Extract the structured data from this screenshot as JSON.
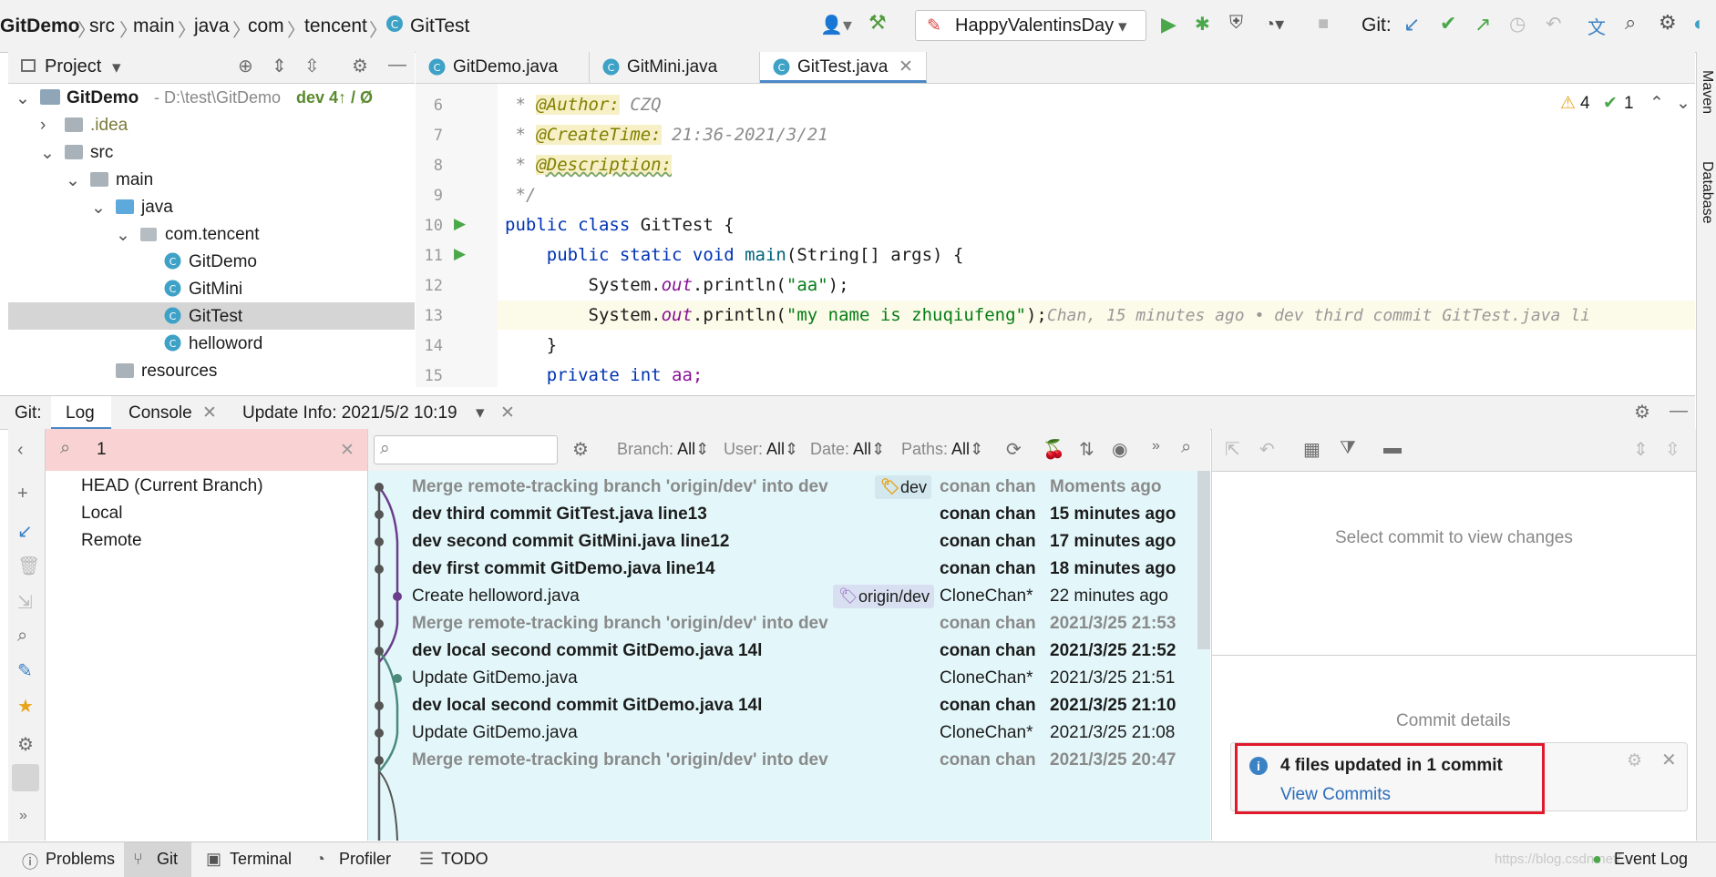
{
  "navbar": {
    "breadcrumbs": [
      "GitDemo",
      "src",
      "main",
      "java",
      "com",
      "tencent",
      "GitTest"
    ],
    "run_config": "HappyValentinsDay",
    "git_label": "Git:"
  },
  "project_panel": {
    "title": "Project",
    "root": {
      "name": "GitDemo",
      "path": "- D:\\test\\GitDemo",
      "branch": "dev 4↑ / Ø"
    },
    "items": [
      {
        "label": ".idea"
      },
      {
        "label": "src"
      },
      {
        "label": "main"
      },
      {
        "label": "java"
      },
      {
        "label": "com.tencent"
      },
      {
        "label": "GitDemo"
      },
      {
        "label": "GitMini"
      },
      {
        "label": "GitTest"
      },
      {
        "label": "helloword"
      },
      {
        "label": "resources"
      }
    ]
  },
  "editor": {
    "tabs": [
      {
        "label": "GitDemo.java"
      },
      {
        "label": "GitMini.java"
      },
      {
        "label": "GitTest.java"
      }
    ],
    "inspection": {
      "warnings": "4",
      "typos": "1"
    },
    "lines": [
      {
        "n": "6",
        "prefix": " * ",
        "tag": "@Author:",
        "rest": " CZQ"
      },
      {
        "n": "7",
        "prefix": " * ",
        "tag": "@CreateTime:",
        "rest": " 21:36-2021/3/21"
      },
      {
        "n": "8",
        "prefix": " * ",
        "tag": "@Description:",
        "rest": ""
      },
      {
        "n": "9",
        "text": " */"
      },
      {
        "n": "10",
        "kw": "public class ",
        "text": "GitTest {"
      },
      {
        "n": "11",
        "kw": "    public static void ",
        "fn": "main",
        "text": "(String[] args) {"
      },
      {
        "n": "12",
        "text": "        System.",
        "field": "out",
        "text2": ".println(",
        "str": "\"aa\"",
        "end": ");"
      },
      {
        "n": "13",
        "text": "        System.",
        "field": "out",
        "text2": ".println(",
        "str": "\"my name is zhuqiufeng\"",
        "end": ");"
      },
      {
        "n": "14",
        "text": "    }"
      },
      {
        "n": "15",
        "kw": "    private int ",
        "text": "aa;"
      }
    ],
    "blame": "Chan, 15 minutes ago • dev third commit GitTest.java li"
  },
  "git_window": {
    "label": "Git:",
    "tabs": [
      {
        "label": "Log"
      },
      {
        "label": "Console"
      },
      {
        "label": "Update Info: 2021/5/2 10:19"
      }
    ],
    "branch_filter_value": "1",
    "branches": [
      {
        "label": "HEAD (Current Branch)"
      },
      {
        "label": "Local"
      },
      {
        "label": "Remote"
      }
    ],
    "filters": [
      {
        "name": "Branch:",
        "value": "All"
      },
      {
        "name": "User:",
        "value": "All"
      },
      {
        "name": "Date:",
        "value": "All"
      },
      {
        "name": "Paths:",
        "value": "All"
      }
    ],
    "commits": [
      {
        "message": "Merge remote-tracking branch 'origin/dev' into dev",
        "author": "conan chan",
        "date": "Moments ago",
        "style": "merge",
        "tag": "dev"
      },
      {
        "message": "dev third commit GitTest.java line13",
        "author": "conan chan",
        "date": "15 minutes ago",
        "style": "bold"
      },
      {
        "message": "dev second commit GitMini.java line12",
        "author": "conan chan",
        "date": "17 minutes ago",
        "style": "bold"
      },
      {
        "message": "dev first   commit GitDemo.java line14",
        "author": "conan chan",
        "date": "18 minutes ago",
        "style": "bold"
      },
      {
        "message": "Create helloword.java",
        "author": "CloneChan*",
        "date": "22 minutes ago",
        "style": "normal",
        "tag": "origin/dev"
      },
      {
        "message": "Merge remote-tracking branch 'origin/dev' into dev",
        "author": "conan chan",
        "date": "2021/3/25 21:53",
        "style": "merge"
      },
      {
        "message": "dev local second  commit GitDemo.java 14l",
        "author": "conan chan",
        "date": "2021/3/25 21:52",
        "style": "bold"
      },
      {
        "message": "Update GitDemo.java",
        "author": "CloneChan*",
        "date": "2021/3/25 21:51",
        "style": "normal"
      },
      {
        "message": "dev local second  commit GitDemo.java 14l",
        "author": "conan chan",
        "date": "2021/3/25 21:10",
        "style": "bold"
      },
      {
        "message": "Update GitDemo.java",
        "author": "CloneChan*",
        "date": "2021/3/25 21:08",
        "style": "normal"
      },
      {
        "message": "Merge remote-tracking branch 'origin/dev' into dev",
        "author": "conan chan",
        "date": "2021/3/25 20:47",
        "style": "merge"
      }
    ],
    "changes_placeholder": "Select commit to view changes",
    "details_placeholder": "Commit details",
    "notification": {
      "title": "4 files updated in 1 commit",
      "link": "View Commits"
    }
  },
  "bottom_bar": {
    "tabs": [
      {
        "label": "Problems"
      },
      {
        "label": "Git"
      },
      {
        "label": "Terminal"
      },
      {
        "label": "Profiler"
      },
      {
        "label": "TODO"
      }
    ],
    "event_log": "Event Log",
    "watermark": "https://blog.csdn.net/..."
  },
  "right_stripe": {
    "maven": "Maven",
    "database": "Database"
  },
  "colors": {
    "accent": "#4a88c7",
    "log_background": "#e3f7fa",
    "keyword": "#0033b3",
    "string": "#067d17",
    "annotation": "#808000",
    "highlight_line": "#fcfae8",
    "notification_border": "#e0192b"
  }
}
